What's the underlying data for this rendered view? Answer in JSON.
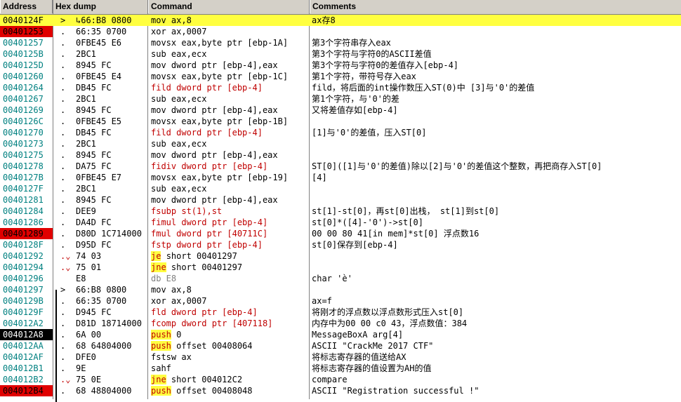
{
  "columns": {
    "address": "Address",
    "hex": "Hex dump",
    "command": "Command",
    "comments": "Comments"
  },
  "rows": [
    {
      "addr": "0040124F",
      "mark": ">",
      "hex": "↳66:B8 0800",
      "cmd": "mov ax,8",
      "style": "normal",
      "cmt": "ax存8",
      "addr_style": "cur",
      "row_hl": true
    },
    {
      "addr": "00401253",
      "mark": ".",
      "hex": "66:35 0700",
      "cmd": "xor ax,0007",
      "style": "normal",
      "cmt": "",
      "addr_style": "bp"
    },
    {
      "addr": "00401257",
      "mark": ".",
      "hex": "0FBE45 E6",
      "cmd": "movsx eax,byte ptr [ebp-1A]",
      "style": "normal",
      "cmt": "第3个字符串存入eax",
      "addr_style": "norm"
    },
    {
      "addr": "0040125B",
      "mark": ".",
      "hex": "2BC1",
      "cmd": "sub eax,ecx",
      "style": "normal",
      "cmt": "第3个字符与字符0的ASCII差值",
      "addr_style": "norm"
    },
    {
      "addr": "0040125D",
      "mark": ".",
      "hex": "8945 FC",
      "cmd": "mov dword ptr [ebp-4],eax",
      "style": "normal",
      "cmt": "第3个字符与字符0的差值存入[ebp-4]",
      "addr_style": "norm"
    },
    {
      "addr": "00401260",
      "mark": ".",
      "hex": "0FBE45 E4",
      "cmd": "movsx eax,byte ptr [ebp-1C]",
      "style": "normal",
      "cmt": "第1个字符，带符号存入eax",
      "addr_style": "norm"
    },
    {
      "addr": "00401264",
      "mark": ".",
      "hex": "DB45 FC",
      "cmd": "fild dword ptr [ebp-4]",
      "style": "red",
      "cmt": "fild，将后面的int操作数压入ST(0)中  [3]与'0'的差值",
      "addr_style": "norm"
    },
    {
      "addr": "00401267",
      "mark": ".",
      "hex": "2BC1",
      "cmd": "sub eax,ecx",
      "style": "normal",
      "cmt": "第1个字符，与'0'的差",
      "addr_style": "norm"
    },
    {
      "addr": "00401269",
      "mark": ".",
      "hex": "8945 FC",
      "cmd": "mov dword ptr [ebp-4],eax",
      "style": "normal",
      "cmt": "又将差值存如[ebp-4]",
      "addr_style": "norm"
    },
    {
      "addr": "0040126C",
      "mark": ".",
      "hex": "0FBE45 E5",
      "cmd": "movsx eax,byte ptr [ebp-1B]",
      "style": "normal",
      "cmt": "",
      "addr_style": "norm"
    },
    {
      "addr": "00401270",
      "mark": ".",
      "hex": "DB45 FC",
      "cmd": "fild dword ptr [ebp-4]",
      "style": "red",
      "cmt": "[1]与'0'的差值，压入ST[0]",
      "addr_style": "norm"
    },
    {
      "addr": "00401273",
      "mark": ".",
      "hex": "2BC1",
      "cmd": "sub eax,ecx",
      "style": "normal",
      "cmt": "",
      "addr_style": "norm"
    },
    {
      "addr": "00401275",
      "mark": ".",
      "hex": "8945 FC",
      "cmd": "mov dword ptr [ebp-4],eax",
      "style": "normal",
      "cmt": "",
      "addr_style": "norm"
    },
    {
      "addr": "00401278",
      "mark": ".",
      "hex": "DA75 FC",
      "cmd": "fidiv dword ptr [ebp-4]",
      "style": "red",
      "cmt": "ST[0]([1]与'0'的差值)除以[2]与'0'的差值这个整数，再把商存入ST[0]",
      "addr_style": "norm"
    },
    {
      "addr": "0040127B",
      "mark": ".",
      "hex": "0FBE45 E7",
      "cmd": "movsx eax,byte ptr [ebp-19]",
      "style": "normal",
      "cmt": "[4]",
      "addr_style": "norm"
    },
    {
      "addr": "0040127F",
      "mark": ".",
      "hex": "2BC1",
      "cmd": "sub eax,ecx",
      "style": "normal",
      "cmt": "",
      "addr_style": "norm"
    },
    {
      "addr": "00401281",
      "mark": ".",
      "hex": "8945 FC",
      "cmd": "mov dword ptr [ebp-4],eax",
      "style": "normal",
      "cmt": "",
      "addr_style": "norm"
    },
    {
      "addr": "00401284",
      "mark": ".",
      "hex": "DEE9",
      "cmd": "fsubp st(1),st",
      "style": "red",
      "cmt": "st[1]-st[0]，再st[0]出栈， st[1]到st[0]",
      "addr_style": "norm"
    },
    {
      "addr": "00401286",
      "mark": ".",
      "hex": "DA4D FC",
      "cmd": "fimul dword ptr [ebp-4]",
      "style": "red",
      "cmt": "st[0]*([4]-'0')->st[0]",
      "addr_style": "norm"
    },
    {
      "addr": "00401289",
      "mark": ".",
      "hex": "D80D 1C714000",
      "cmd": "fmul dword ptr [40711C]",
      "style": "redred",
      "cmt": "00 00 80 41[in mem]*st[0] 浮点数16",
      "addr_style": "bp"
    },
    {
      "addr": "0040128F",
      "mark": ".",
      "hex": "D95D FC",
      "cmd": "fstp dword ptr [ebp-4]",
      "style": "red",
      "cmt": "st[0]保存到[ebp-4]",
      "addr_style": "norm"
    },
    {
      "addr": "00401292",
      "mark": ".⌄",
      "hex": "74 03",
      "cmd_k": "je",
      "cmd_r": "short 00401297",
      "style": "jump",
      "cmt": "",
      "addr_style": "norm"
    },
    {
      "addr": "00401294",
      "mark": ".⌄",
      "hex": "75 01",
      "cmd_k": "jne",
      "cmd_r": "short 00401297",
      "style": "jump",
      "cmt": "",
      "addr_style": "norm"
    },
    {
      "addr": "00401296",
      "mark": "",
      "hex": "E8",
      "cmd": "db E8",
      "style": "grey",
      "cmt": "char 'è'",
      "addr_style": "norm"
    },
    {
      "addr": "00401297",
      "mark": ">",
      "hex": "66:B8 0800",
      "cmd": "mov ax,8",
      "style": "normal",
      "cmt": "",
      "addr_style": "norm"
    },
    {
      "addr": "0040129B",
      "mark": ".",
      "hex": "66:35 0700",
      "cmd": "xor ax,0007",
      "style": "normal",
      "cmt": "ax=f",
      "addr_style": "norm"
    },
    {
      "addr": "0040129F",
      "mark": ".",
      "hex": "D945 FC",
      "cmd": "fld dword ptr [ebp-4]",
      "style": "red",
      "cmt": "将刚才的浮点数以浮点数形式压入st[0]",
      "addr_style": "norm"
    },
    {
      "addr": "004012A2",
      "mark": ".",
      "hex": "D81D 18714000",
      "cmd": "fcomp dword ptr [407118]",
      "style": "redred",
      "cmt": "内存中为00 00 c0 43，浮点数值：384",
      "addr_style": "norm"
    },
    {
      "addr": "004012A8",
      "mark": ".",
      "hex": "6A 00",
      "cmd_k": "push",
      "cmd_r": "0",
      "style": "push",
      "cmt": "MessageBoxA arg[4]",
      "addr_style": "sel"
    },
    {
      "addr": "004012AA",
      "mark": ".",
      "hex": "68 64804000",
      "cmd_k": "push",
      "cmd_r": "offset 00408064",
      "style": "push",
      "cmt": "ASCII \"CrackMe 2017 CTF\"",
      "addr_style": "norm"
    },
    {
      "addr": "004012AF",
      "mark": ".",
      "hex": "DFE0",
      "cmd": "fstsw ax",
      "style": "normal",
      "cmt": "将标志寄存器的值送给AX",
      "addr_style": "norm"
    },
    {
      "addr": "004012B1",
      "mark": ".",
      "hex": "9E",
      "cmd": "sahf",
      "style": "normal",
      "cmt": "将标志寄存器的值设置为AH的值",
      "addr_style": "norm"
    },
    {
      "addr": "004012B2",
      "mark": ".⌄",
      "hex": "75 0E",
      "cmd_k": "jne",
      "cmd_r": "short 004012C2",
      "style": "jump",
      "cmt": "compare",
      "addr_style": "norm"
    },
    {
      "addr": "004012B4",
      "mark": ".",
      "hex": "68 48804000",
      "cmd_k": "push",
      "cmd_r": "offset 00408048",
      "style": "push",
      "cmt": "ASCII \"Registration successful !\"",
      "addr_style": "bp"
    }
  ]
}
